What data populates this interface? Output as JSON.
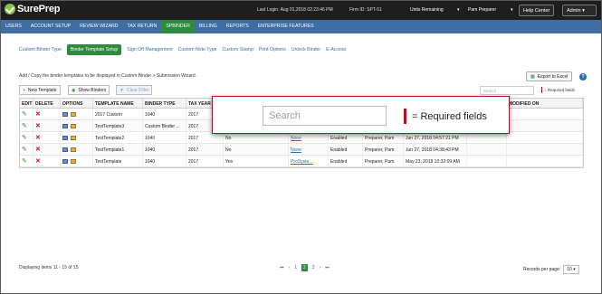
{
  "header": {
    "logo": "SurePrep",
    "last_login": "Last Login:  Aug 01,2018 02:23:46 PM",
    "firm_id": "Firm ID:   SPT-51",
    "units": "Units Remaining",
    "user": "Pam Preparer",
    "help": "Help Center",
    "role": "Admin"
  },
  "nav": [
    "USERS",
    "ACCOUNT SETUP",
    "REVIEW WIZARD",
    "TAX RETURN",
    "SPBINDER",
    "BILLING",
    "REPORTS",
    "ENTERPRISE FEATURES"
  ],
  "subtabs": [
    "Custom Binder Type",
    "Binder Template Setup",
    "Sign Off Management",
    "Custom Note Type",
    "Custom Stamp",
    "Print Options",
    "Unlock Binder",
    "E-Access"
  ],
  "description": "Add / Copy the binder templates to be displayed in Custom Binder > Submission Wizard.",
  "export": "Export to Excel",
  "toolbar": {
    "new": "New Template",
    "show": "Show Binders",
    "clear": "Clear Filter"
  },
  "search": {
    "placeholder": "Search"
  },
  "required": "= Required fields",
  "columns": [
    "EDIT",
    "DELETE",
    "OPTIONS",
    "TEMPLATE NAME",
    "BINDER TYPE",
    "TAX YEAR",
    "MODIFIED ON"
  ],
  "rows": [
    {
      "name": "2017 Custom",
      "type": "1040",
      "year": "2017",
      "x1": "",
      "x2": "",
      "x3": "",
      "x4": "",
      "x5": "",
      "x6": ""
    },
    {
      "name": "TestTemplate3",
      "type": "Custom Binder ...",
      "year": "2017",
      "x1": "",
      "x2": "",
      "x3": "",
      "x4": "",
      "x5": "",
      "x6": ""
    },
    {
      "name": "TestTemplate2",
      "type": "1040",
      "year": "2017",
      "x1": "No",
      "x2": "None",
      "x3": "Enabled",
      "x4": "Preparer, Pam",
      "x5": "Jun 27, 2018 04:57:21 PM",
      "x6": ""
    },
    {
      "name": "TestTemplate1",
      "type": "1040",
      "year": "2017",
      "x1": "No",
      "x2": "None",
      "x3": "Enabled",
      "x4": "Preparer, Pam",
      "x5": "Jun 27, 2018 04:38:43 PM",
      "x6": ""
    },
    {
      "name": "TestTemplate",
      "type": "1040",
      "year": "2017",
      "x1": "Yes",
      "x2": "ProSyste...",
      "x3": "Enabled",
      "x4": "Preparer, Pam",
      "x5": "May 23, 2018 10:32:09 AM",
      "x6": ""
    }
  ],
  "footer": {
    "displaying": "Displaying items 11 - 15 of 15",
    "pages": [
      "1",
      "2",
      "3"
    ],
    "current_page": "2",
    "rpp_label": "Records per page:",
    "rpp_value": "10"
  }
}
